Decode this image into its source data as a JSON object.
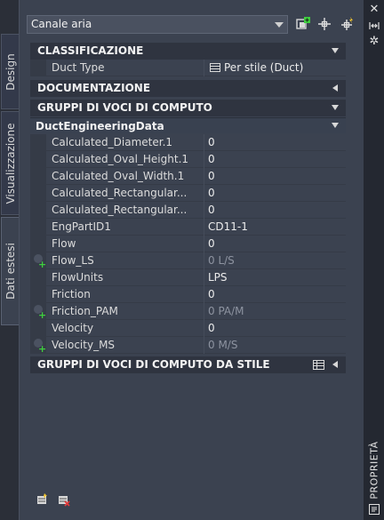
{
  "toolbar": {
    "style_selector_value": "Canale aria"
  },
  "side_tabs": [
    "Design",
    "Visualizzazione",
    "Dati estesi"
  ],
  "right_strip": {
    "label": "PROPRIETÀ"
  },
  "sections": {
    "classificazione": "CLASSIFICAZIONE",
    "documentazione": "DOCUMENTAZIONE",
    "gruppi": "GRUPPI DI VOCI DI COMPUTO",
    "ducteng": "DuctEngineeringData",
    "gruppi_stile": "GRUPPI DI VOCI DI COMPUTO DA STILE"
  },
  "duct_type": {
    "key": "Duct Type",
    "value": "Per stile (Duct)"
  },
  "properties": [
    {
      "key": "Calculated_Diameter.1",
      "value": "0"
    },
    {
      "key": "Calculated_Oval_Height.1",
      "value": "0"
    },
    {
      "key": "Calculated_Oval_Width.1",
      "value": "0"
    },
    {
      "key": "Calculated_Rectangular...",
      "value": "0"
    },
    {
      "key": "Calculated_Rectangular...",
      "value": "0"
    },
    {
      "key": "EngPartID1",
      "value": "CD11-1"
    },
    {
      "key": "Flow",
      "value": "0"
    },
    {
      "key": "Flow_LS",
      "value": "0 L/S"
    },
    {
      "key": "FlowUnits",
      "value": "LPS"
    },
    {
      "key": "Friction",
      "value": "0"
    },
    {
      "key": "Friction_PAM",
      "value": "0 PA/M"
    },
    {
      "key": "Velocity",
      "value": "0"
    },
    {
      "key": "Velocity_MS",
      "value": "0 M/S"
    }
  ]
}
